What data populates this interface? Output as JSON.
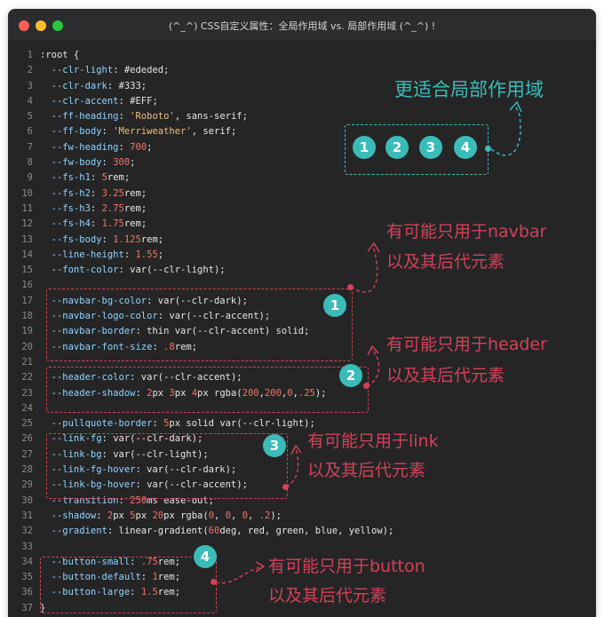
{
  "window": {
    "title": "(^_^) CSS自定义属性：全局作用域 vs. 局部作用域 (^_^) !"
  },
  "code_lines": [
    {
      "n": "1",
      "t": [
        {
          "c": "plain",
          "v": ":root {"
        }
      ]
    },
    {
      "n": "2",
      "t": [
        {
          "c": "prop",
          "v": "  --clr-light"
        },
        {
          "c": "plain",
          "v": ": #ededed;"
        }
      ]
    },
    {
      "n": "3",
      "t": [
        {
          "c": "prop",
          "v": "  --clr-dark"
        },
        {
          "c": "plain",
          "v": ": #333;"
        }
      ]
    },
    {
      "n": "4",
      "t": [
        {
          "c": "prop",
          "v": "  --clr-accent"
        },
        {
          "c": "plain",
          "v": ": #EFF;"
        }
      ]
    },
    {
      "n": "5",
      "t": [
        {
          "c": "prop",
          "v": "  --ff-heading"
        },
        {
          "c": "plain",
          "v": ": "
        },
        {
          "c": "str",
          "v": "'Roboto'"
        },
        {
          "c": "plain",
          "v": ", sans-serif;"
        }
      ]
    },
    {
      "n": "6",
      "t": [
        {
          "c": "prop",
          "v": "  --ff-body"
        },
        {
          "c": "plain",
          "v": ": "
        },
        {
          "c": "str",
          "v": "'Merriweather'"
        },
        {
          "c": "plain",
          "v": ", serif;"
        }
      ]
    },
    {
      "n": "7",
      "t": [
        {
          "c": "prop",
          "v": "  --fw-heading"
        },
        {
          "c": "plain",
          "v": ": "
        },
        {
          "c": "num",
          "v": "700"
        },
        {
          "c": "plain",
          "v": ";"
        }
      ]
    },
    {
      "n": "8",
      "t": [
        {
          "c": "prop",
          "v": "  --fw-body"
        },
        {
          "c": "plain",
          "v": ": "
        },
        {
          "c": "num",
          "v": "300"
        },
        {
          "c": "plain",
          "v": ";"
        }
      ]
    },
    {
      "n": "9",
      "t": [
        {
          "c": "prop",
          "v": "  --fs-h1"
        },
        {
          "c": "plain",
          "v": ": "
        },
        {
          "c": "num",
          "v": "5"
        },
        {
          "c": "plain",
          "v": "rem;"
        }
      ]
    },
    {
      "n": "10",
      "t": [
        {
          "c": "prop",
          "v": "  --fs-h2"
        },
        {
          "c": "plain",
          "v": ": "
        },
        {
          "c": "num",
          "v": "3.25"
        },
        {
          "c": "plain",
          "v": "rem;"
        }
      ]
    },
    {
      "n": "11",
      "t": [
        {
          "c": "prop",
          "v": "  --fs-h3"
        },
        {
          "c": "plain",
          "v": ": "
        },
        {
          "c": "num",
          "v": "2.75"
        },
        {
          "c": "plain",
          "v": "rem;"
        }
      ]
    },
    {
      "n": "12",
      "t": [
        {
          "c": "prop",
          "v": "  --fs-h4"
        },
        {
          "c": "plain",
          "v": ": "
        },
        {
          "c": "num",
          "v": "1.75"
        },
        {
          "c": "plain",
          "v": "rem;"
        }
      ]
    },
    {
      "n": "13",
      "t": [
        {
          "c": "prop",
          "v": "  --fs-body"
        },
        {
          "c": "plain",
          "v": ": "
        },
        {
          "c": "num",
          "v": "1.125"
        },
        {
          "c": "plain",
          "v": "rem;"
        }
      ]
    },
    {
      "n": "14",
      "t": [
        {
          "c": "prop",
          "v": "  --line-height"
        },
        {
          "c": "plain",
          "v": ": "
        },
        {
          "c": "num",
          "v": "1.55"
        },
        {
          "c": "plain",
          "v": ";"
        }
      ]
    },
    {
      "n": "15",
      "t": [
        {
          "c": "prop",
          "v": "  --font-color"
        },
        {
          "c": "plain",
          "v": ": var(--clr-light);"
        }
      ]
    },
    {
      "n": "16",
      "t": []
    },
    {
      "n": "17",
      "t": [
        {
          "c": "prop",
          "v": "  --navbar-bg-color"
        },
        {
          "c": "plain",
          "v": ": var(--clr-dark);"
        }
      ]
    },
    {
      "n": "18",
      "t": [
        {
          "c": "prop",
          "v": "  --navbar-logo-color"
        },
        {
          "c": "plain",
          "v": ": var(--clr-accent);"
        }
      ]
    },
    {
      "n": "19",
      "t": [
        {
          "c": "prop",
          "v": "  --navbar-border"
        },
        {
          "c": "plain",
          "v": ": thin var(--clr-accent) solid;"
        }
      ]
    },
    {
      "n": "20",
      "t": [
        {
          "c": "prop",
          "v": "  --navbar-font-size"
        },
        {
          "c": "plain",
          "v": ": "
        },
        {
          "c": "num",
          "v": ".8"
        },
        {
          "c": "plain",
          "v": "rem;"
        }
      ]
    },
    {
      "n": "21",
      "t": []
    },
    {
      "n": "22",
      "t": [
        {
          "c": "prop",
          "v": "  --header-color"
        },
        {
          "c": "plain",
          "v": ": var(--clr-accent);"
        }
      ]
    },
    {
      "n": "23",
      "t": [
        {
          "c": "prop",
          "v": "  --header-shadow"
        },
        {
          "c": "plain",
          "v": ": "
        },
        {
          "c": "num",
          "v": "2"
        },
        {
          "c": "plain",
          "v": "px "
        },
        {
          "c": "num",
          "v": "3"
        },
        {
          "c": "plain",
          "v": "px "
        },
        {
          "c": "num",
          "v": "4"
        },
        {
          "c": "plain",
          "v": "px rgba("
        },
        {
          "c": "num",
          "v": "200"
        },
        {
          "c": "plain",
          "v": ","
        },
        {
          "c": "num",
          "v": "200"
        },
        {
          "c": "plain",
          "v": ","
        },
        {
          "c": "num",
          "v": "0"
        },
        {
          "c": "plain",
          "v": ","
        },
        {
          "c": "num",
          "v": ".25"
        },
        {
          "c": "plain",
          "v": ");"
        }
      ]
    },
    {
      "n": "24",
      "t": []
    },
    {
      "n": "25",
      "t": [
        {
          "c": "prop",
          "v": "  --pullquote-border"
        },
        {
          "c": "plain",
          "v": ": "
        },
        {
          "c": "num",
          "v": "5"
        },
        {
          "c": "plain",
          "v": "px solid var(--clr-light);"
        }
      ]
    },
    {
      "n": "26",
      "t": [
        {
          "c": "prop",
          "v": "  --link-fg"
        },
        {
          "c": "plain",
          "v": ": var(--clr-dark);"
        }
      ]
    },
    {
      "n": "27",
      "t": [
        {
          "c": "prop",
          "v": "  --link-bg"
        },
        {
          "c": "plain",
          "v": ": var(--clr-light);"
        }
      ]
    },
    {
      "n": "28",
      "t": [
        {
          "c": "prop",
          "v": "  --link-fg-hover"
        },
        {
          "c": "plain",
          "v": ": var(--clr-dark);"
        }
      ]
    },
    {
      "n": "29",
      "t": [
        {
          "c": "prop",
          "v": "  --link-bg-hover"
        },
        {
          "c": "plain",
          "v": ": var(--clr-accent);"
        }
      ]
    },
    {
      "n": "30",
      "t": [
        {
          "c": "prop",
          "v": "  --transition"
        },
        {
          "c": "plain",
          "v": ": "
        },
        {
          "c": "num",
          "v": "250"
        },
        {
          "c": "plain",
          "v": "ms ease-out;"
        }
      ]
    },
    {
      "n": "31",
      "t": [
        {
          "c": "prop",
          "v": "  --shadow"
        },
        {
          "c": "plain",
          "v": ": "
        },
        {
          "c": "num",
          "v": "2"
        },
        {
          "c": "plain",
          "v": "px "
        },
        {
          "c": "num",
          "v": "5"
        },
        {
          "c": "plain",
          "v": "px "
        },
        {
          "c": "num",
          "v": "20"
        },
        {
          "c": "plain",
          "v": "px rgba("
        },
        {
          "c": "num",
          "v": "0"
        },
        {
          "c": "plain",
          "v": ", "
        },
        {
          "c": "num",
          "v": "0"
        },
        {
          "c": "plain",
          "v": ", "
        },
        {
          "c": "num",
          "v": "0"
        },
        {
          "c": "plain",
          "v": ", "
        },
        {
          "c": "num",
          "v": ".2"
        },
        {
          "c": "plain",
          "v": ");"
        }
      ]
    },
    {
      "n": "32",
      "t": [
        {
          "c": "prop",
          "v": "  --gradient"
        },
        {
          "c": "plain",
          "v": ": linear-gradient("
        },
        {
          "c": "num",
          "v": "60"
        },
        {
          "c": "plain",
          "v": "deg, red, green, blue, yellow);"
        }
      ]
    },
    {
      "n": "33",
      "t": []
    },
    {
      "n": "34",
      "t": [
        {
          "c": "prop",
          "v": "  --button-small"
        },
        {
          "c": "plain",
          "v": ": "
        },
        {
          "c": "num",
          "v": ".75"
        },
        {
          "c": "plain",
          "v": "rem;"
        }
      ]
    },
    {
      "n": "35",
      "t": [
        {
          "c": "prop",
          "v": "  --button-default"
        },
        {
          "c": "plain",
          "v": ": "
        },
        {
          "c": "num",
          "v": "1"
        },
        {
          "c": "plain",
          "v": "rem;"
        }
      ]
    },
    {
      "n": "36",
      "t": [
        {
          "c": "prop",
          "v": "  --button-large"
        },
        {
          "c": "plain",
          "v": ": "
        },
        {
          "c": "num",
          "v": "1.5"
        },
        {
          "c": "plain",
          "v": "rem;"
        }
      ]
    },
    {
      "n": "37",
      "t": [
        {
          "c": "plain",
          "v": "}"
        }
      ]
    }
  ],
  "annotations": {
    "scope_title": "更适合局部作用域",
    "circles": [
      "1",
      "2",
      "3",
      "4"
    ],
    "notes": [
      {
        "num": "1",
        "line1": "有可能只用于navbar",
        "line2": "以及其后代元素"
      },
      {
        "num": "2",
        "line1": "有可能只用于header",
        "line2": "以及其后代元素"
      },
      {
        "num": "3",
        "line1": "有可能只用于link",
        "line2": "以及其后代元素"
      },
      {
        "num": "4",
        "line1": "有可能只用于button",
        "line2": "以及其后代元素"
      }
    ]
  },
  "colors": {
    "annotation_red": "#d2415a",
    "annotation_teal": "#3bbcb9",
    "prop_blue": "#8fd4ff",
    "number_red": "#f0756b",
    "string_yellow": "#e8c07d"
  }
}
